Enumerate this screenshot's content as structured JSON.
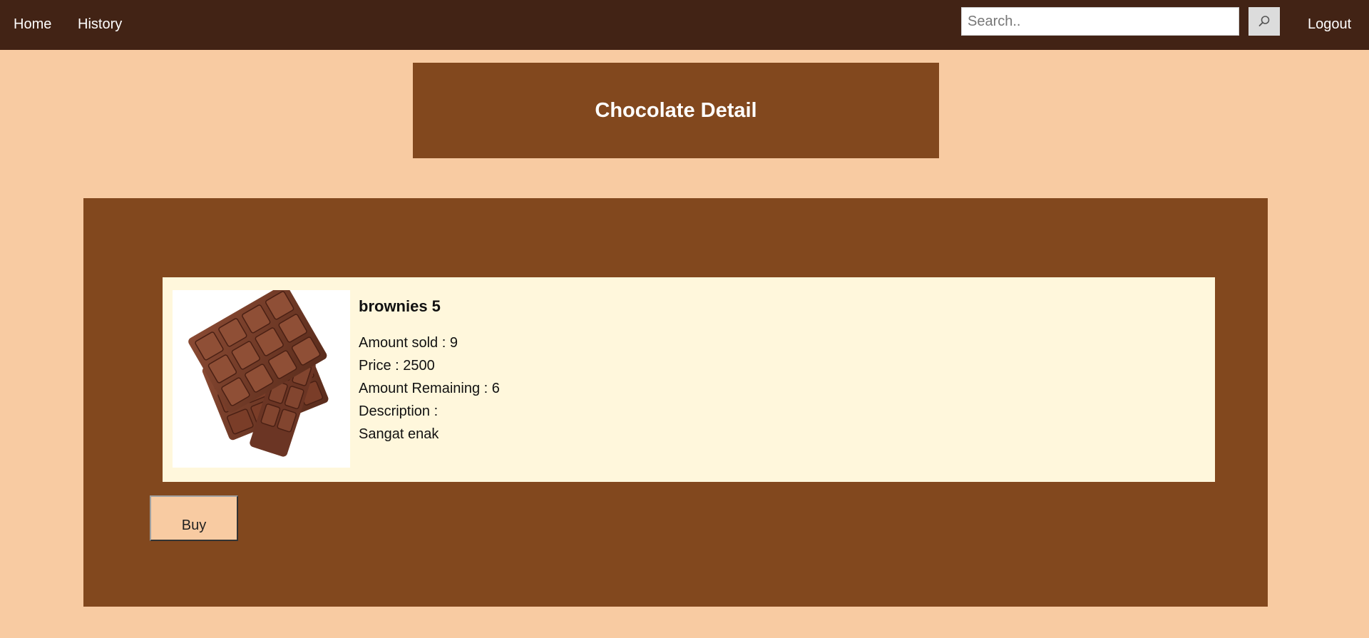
{
  "nav": {
    "home_label": "Home",
    "history_label": "History",
    "search_placeholder": "Search..",
    "search_value": "",
    "logout_label": "Logout"
  },
  "header": {
    "title": "Chocolate Detail"
  },
  "product": {
    "name": "brownies 5",
    "amount_sold_line": "Amount sold : 9",
    "price_line": "Price : 2500",
    "amount_remaining_line": "Amount Remaining : 6",
    "description_label": "Description :",
    "description": "Sangat enak",
    "image_icon": "chocolate-bar-image"
  },
  "actions": {
    "buy_label": "Buy"
  },
  "colors": {
    "background": "#f8cba2",
    "navbar": "#422315",
    "panel": "#82481e",
    "card": "#fff7dc"
  }
}
